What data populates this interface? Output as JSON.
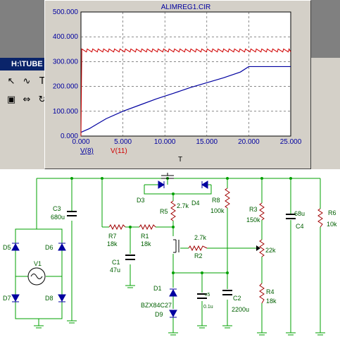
{
  "app": {
    "window_title": "H:\\TUBE",
    "tool_icons": [
      "pointer-icon",
      "wire-icon",
      "text-tool-icon",
      "component-icon",
      "flip-icon",
      "rotate-icon"
    ]
  },
  "plot": {
    "title": "ALIMREG1.CIR",
    "xlabel": "T",
    "y_ticks": [
      "500.000",
      "400.000",
      "300.000",
      "200.000",
      "100.000",
      "0.000"
    ],
    "x_ticks": [
      "0.000",
      "5.000",
      "10.000",
      "15.000",
      "20.000",
      "25.000"
    ],
    "legend": [
      "V(8)",
      "V(11)"
    ],
    "colors": {
      "v8": "#0000a0",
      "v11": "#d00000",
      "grid": "#404040"
    }
  },
  "chart_data": {
    "type": "line",
    "title": "ALIMREG1.CIR",
    "xlabel": "T",
    "ylabel": "",
    "xlim": [
      0,
      25
    ],
    "ylim": [
      0,
      500
    ],
    "grid": true,
    "series": [
      {
        "name": "V(8)",
        "x": [
          0,
          1,
          2,
          3,
          5,
          7,
          9,
          11,
          13,
          15,
          17,
          19,
          20,
          25
        ],
        "values": [
          15,
          30,
          50,
          70,
          100,
          125,
          150,
          172,
          195,
          215,
          235,
          258,
          280,
          280
        ]
      },
      {
        "name": "V(11)",
        "x": [
          0,
          25
        ],
        "values": [
          345,
          345
        ],
        "ripple": 12
      }
    ]
  },
  "schematic": {
    "components": {
      "C3": {
        "ref": "C3",
        "value": "680u"
      },
      "D5": {
        "ref": "D5"
      },
      "D6": {
        "ref": "D6"
      },
      "D7": {
        "ref": "D7"
      },
      "D8": {
        "ref": "D8"
      },
      "V1": {
        "ref": "V1"
      },
      "R7": {
        "ref": "R7",
        "value": "18k"
      },
      "R1": {
        "ref": "R1",
        "value": "18k"
      },
      "C1": {
        "ref": "C1",
        "value": "47u"
      },
      "D3": {
        "ref": "D3"
      },
      "D4": {
        "ref": "D4"
      },
      "R5": {
        "ref": "R5",
        "value": "2.7k"
      },
      "R2": {
        "ref": "R2",
        "value": "2.7k"
      },
      "R8": {
        "ref": "R8",
        "value": "100k"
      },
      "R3": {
        "ref": "R3",
        "value": "150k"
      },
      "POT": {
        "value": "22k"
      },
      "R4": {
        "ref": "R4",
        "value": "18k"
      },
      "C4": {
        "ref": "C4",
        "value": "68u"
      },
      "R6": {
        "ref": "R6",
        "value": "10k"
      },
      "D1": {
        "ref": "D1",
        "value": "BZX84C27"
      },
      "D9": {
        "ref": "D9"
      },
      "C5": {
        "ref": "c5",
        "value": "0.1u"
      },
      "C2": {
        "ref": "C2",
        "value": "2200u"
      }
    }
  }
}
